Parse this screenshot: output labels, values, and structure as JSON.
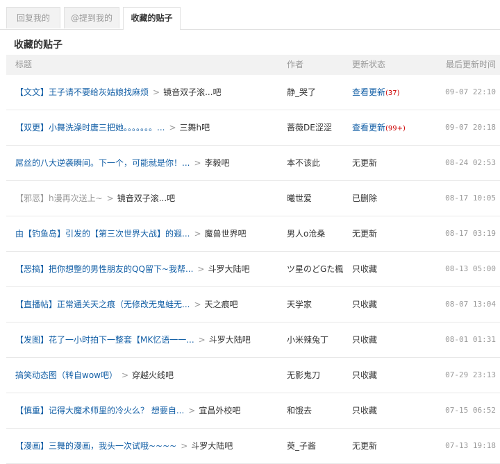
{
  "tabs": [
    {
      "label": "回复我的"
    },
    {
      "label": "@提到我的"
    },
    {
      "label": "收藏的贴子"
    }
  ],
  "section_title": "收藏的贴子",
  "table": {
    "headers": {
      "title": "标题",
      "author": "作者",
      "status": "更新状态",
      "time": "最后更新时间"
    },
    "rows": [
      {
        "title": "【文文】王子请不要给灰姑娘找麻烦",
        "forum": "镜音双子滚...吧",
        "author": "静_哭了",
        "status": "查看更新",
        "count": "(37)",
        "time": "09-07 22:10"
      },
      {
        "title": "【双更】小舞洗澡时唐三把她。。。。。。。...",
        "forum": "三舞h吧",
        "author": "蔷薇DE涩涩",
        "status": "查看更新",
        "count": "(99+)",
        "time": "09-07 20:18"
      },
      {
        "title": "屌丝的八大逆袭瞬间。下一个，可能就是你！...",
        "forum": "李毅吧",
        "author": "本不该此",
        "status": "无更新",
        "count": "",
        "time": "08-24 02:53"
      },
      {
        "title": "【邪恶】h漫再次送上~",
        "forum": "镜音双子滚...吧",
        "author": "曦世爱",
        "status": "已删除",
        "count": "",
        "time": "08-17 10:05"
      },
      {
        "title": "由【钓鱼岛】引发的【第三次世界大战】的遐...",
        "forum": "魔兽世界吧",
        "author": "男人o沧桑",
        "status": "无更新",
        "count": "",
        "time": "08-17 03:19"
      },
      {
        "title": "【恶搞】把你想整的男性朋友的QQ留下~我帮...",
        "forum": "斗罗大陆吧",
        "author": "ツ星のどGた楓",
        "status": "只收藏",
        "count": "",
        "time": "08-13 05:00"
      },
      {
        "title": "【直播帖】正常通关天之痕（无修改无鬼蛙无...",
        "forum": "天之痕吧",
        "author": "天学家",
        "status": "只收藏",
        "count": "",
        "time": "08-07 13:04"
      },
      {
        "title": "【发图】花了一小时拍下一整套【MK忆语一一...",
        "forum": "斗罗大陆吧",
        "author": "小米辣兔丁",
        "status": "只收藏",
        "count": "",
        "time": "08-01 01:31"
      },
      {
        "title": "搞笑动态图（转自wow吧）",
        "forum": "穿越火线吧",
        "author": "无影鬼刀",
        "status": "只收藏",
        "count": "",
        "time": "07-29 23:13"
      },
      {
        "title": "【慎重】记得大魔术师里的冷火么？ 想要自...",
        "forum": "宜昌外校吧",
        "author": "和饿去",
        "status": "只收藏",
        "count": "",
        "time": "07-15 06:52"
      },
      {
        "title": "【漫画】三舞的漫画，我头一次试哦~~~~",
        "forum": "斗罗大陆吧",
        "author": "萸_子酱",
        "status": "无更新",
        "count": "",
        "time": "07-13 19:18"
      }
    ]
  }
}
